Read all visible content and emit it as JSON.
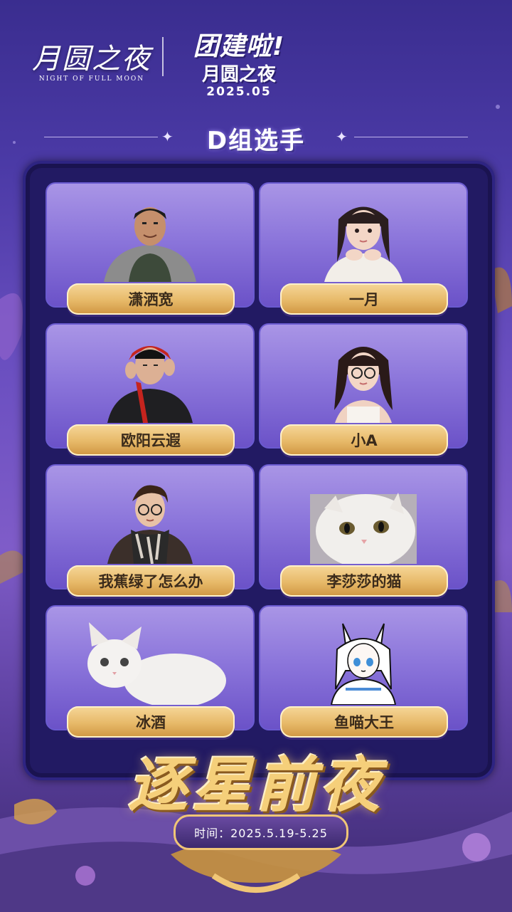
{
  "header": {
    "logo_left_cn": "月圆之夜",
    "logo_left_en": "NIGHT OF FULL MOON",
    "logo_right_line1": "团建啦!",
    "logo_right_line2": "月圆之夜",
    "logo_right_line3": "2025.05"
  },
  "group_title": "D组选手",
  "players": [
    {
      "name": "潇洒宽",
      "avatar": "man-puffer-jacket"
    },
    {
      "name": "一月",
      "avatar": "girl-hands-chin"
    },
    {
      "name": "欧阳云遐",
      "avatar": "man-red-hood"
    },
    {
      "name": "小A",
      "avatar": "girl-glasses"
    },
    {
      "name": "我蕉绿了怎么办",
      "avatar": "guy-glasses-scarf"
    },
    {
      "name": "李莎莎的猫",
      "avatar": "white-cat-face"
    },
    {
      "name": "冰酒",
      "avatar": "white-cat-lying"
    },
    {
      "name": "鱼喵大王",
      "avatar": "anime-bunny-girl"
    }
  ],
  "footer": {
    "title": "逐星前夜",
    "time": "时间：2025.5.19-5.25"
  },
  "colors": {
    "background": "#4b3aa6",
    "board": "#221a63",
    "namebar_gold": "#e7b968",
    "title_gold": "#f5cf7a"
  }
}
